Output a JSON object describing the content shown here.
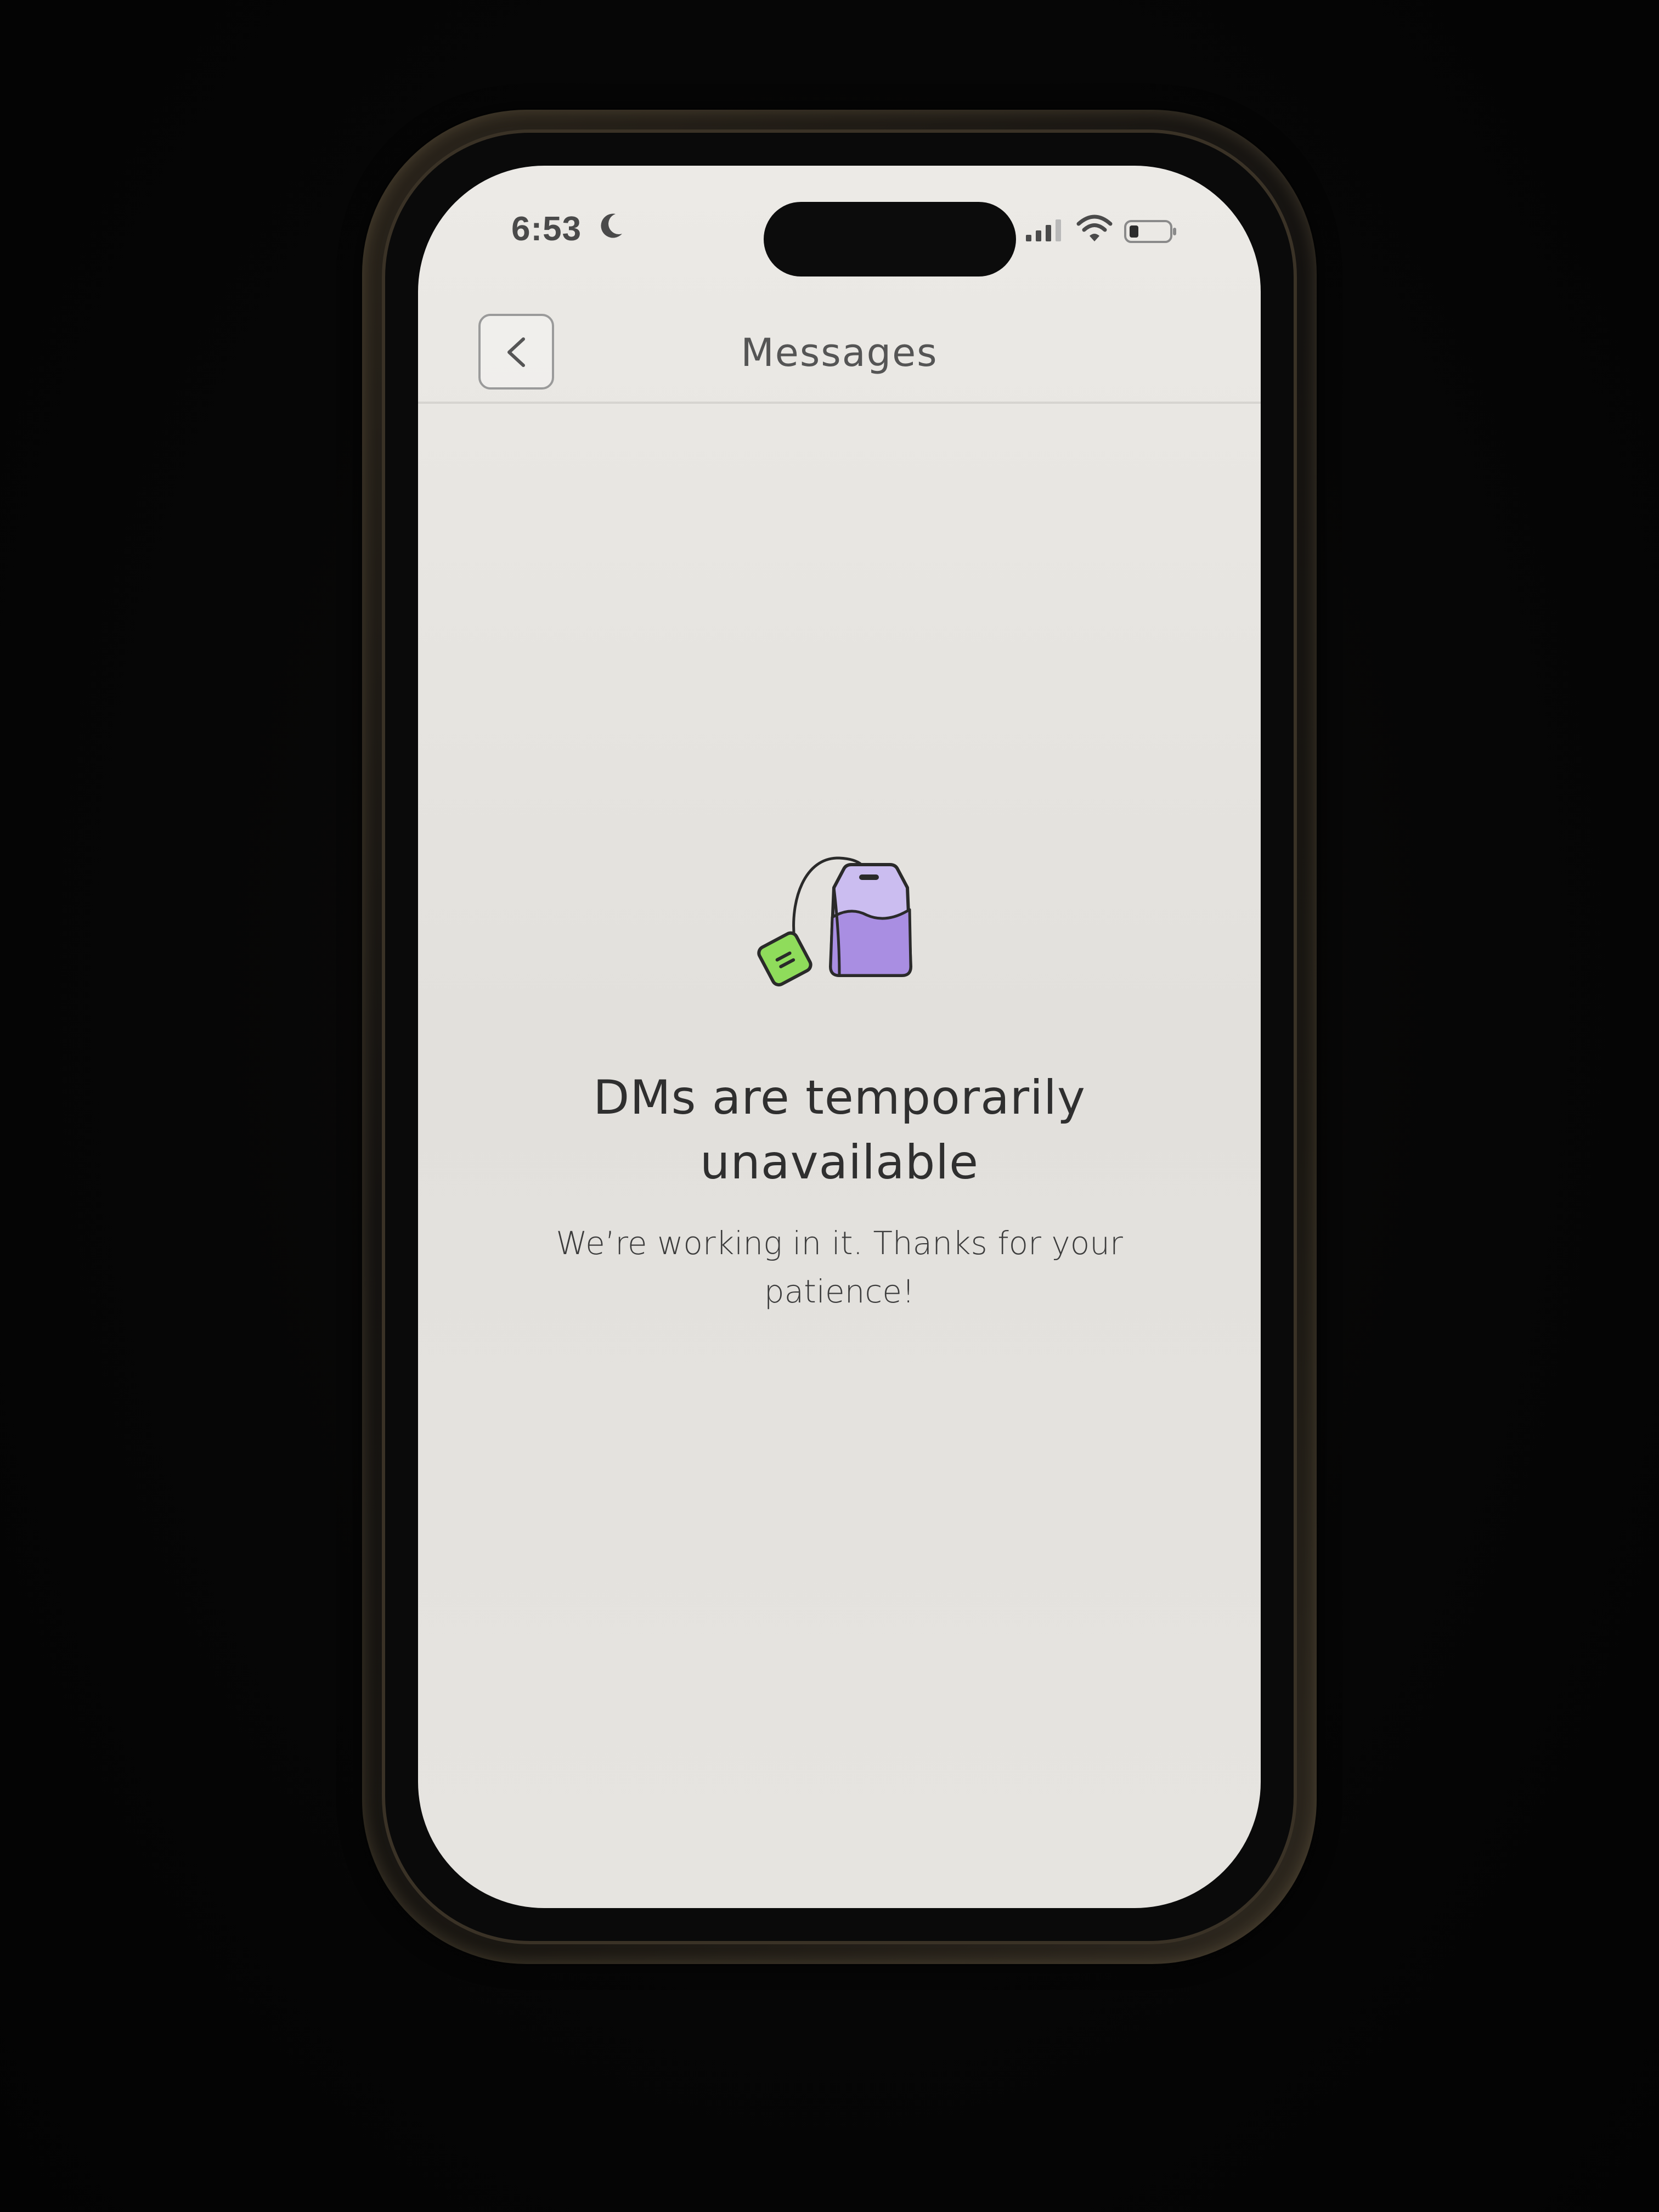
{
  "status_bar": {
    "time": "6:53",
    "icons": [
      "moon-icon",
      "cellular-signal-icon",
      "wifi-icon",
      "battery-icon"
    ]
  },
  "header": {
    "back_icon": "chevron-left-icon",
    "title": "Messages"
  },
  "empty_state": {
    "illustration": "tea-bag-icon",
    "title": "DMs are temporarily unavailable",
    "subtitle": "We’re working in it. Thanks for your patience!"
  },
  "colors": {
    "teabag_fill": "#a98ee2",
    "teabag_top": "#cbbdf0",
    "tag_fill": "#8fdc5b",
    "outline": "#2a2a2a"
  }
}
